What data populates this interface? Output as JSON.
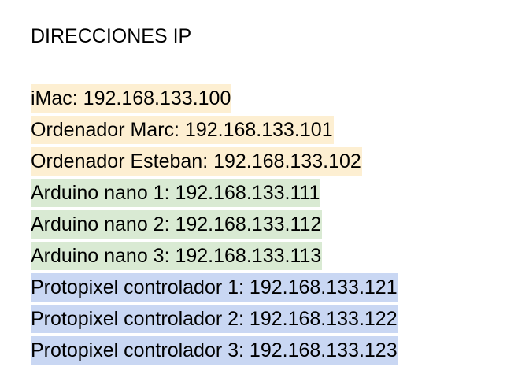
{
  "document": {
    "title": "DIRECCIONES IP",
    "highlight_colors": {
      "computers": "#fdefd2",
      "arduino": "#d9ead3",
      "protopixel": "#c9d7f3"
    },
    "entries": [
      {
        "text": "iMac: 192.168.133.100",
        "group": "computers"
      },
      {
        "text": "Ordenador Marc: 192.168.133.101",
        "group": "computers"
      },
      {
        "text": "Ordenador Esteban: 192.168.133.102",
        "group": "computers"
      },
      {
        "text": "Arduino nano 1: 192.168.133.111",
        "group": "arduino"
      },
      {
        "text": "Arduino nano 2: 192.168.133.112",
        "group": "arduino"
      },
      {
        "text": "Arduino nano 3: 192.168.133.113",
        "group": "arduino"
      },
      {
        "text": "Protopixel controlador 1: 192.168.133.121",
        "group": "protopixel"
      },
      {
        "text": "Protopixel controlador 2: 192.168.133.122",
        "group": "protopixel"
      },
      {
        "text": "Protopixel controlador 3: 192.168.133.123",
        "group": "protopixel"
      }
    ]
  }
}
